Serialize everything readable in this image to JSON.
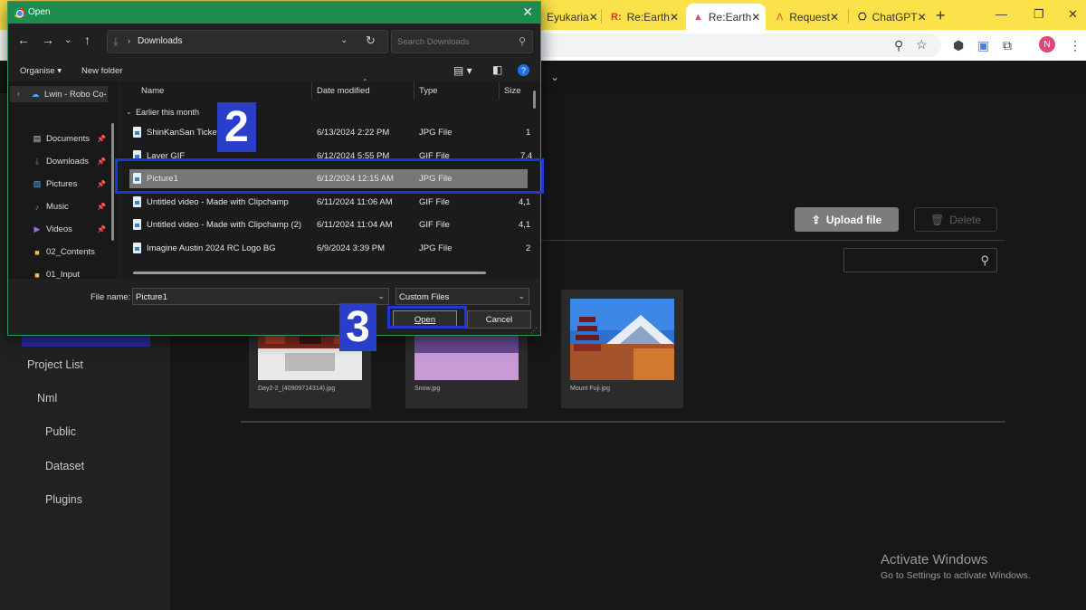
{
  "browser": {
    "tabs": [
      {
        "label": "Eyukaria",
        "icon": "doc-tab-icon"
      },
      {
        "label": "Re:Earth",
        "icon": "reearth-r-icon"
      },
      {
        "label": "Re:Earth",
        "icon": "reearth-a-icon",
        "active": true
      },
      {
        "label": "Request",
        "icon": "reearth-a-icon"
      },
      {
        "label": "ChatGPT",
        "icon": "chatgpt-icon"
      }
    ],
    "avatar_initial": "N",
    "colors": {
      "tabstrip": "#fbe24a",
      "avatar": "#e0457b"
    }
  },
  "app": {
    "sidebar": {
      "items": [
        "Project List",
        "Nml",
        "Public",
        "Dataset",
        "Plugins"
      ]
    },
    "upload_label": "Upload file",
    "delete_label": "Delete",
    "assets": [
      {
        "name": "Day2-2_(40909714314).jpg"
      },
      {
        "name": "Snow.jpg"
      },
      {
        "name": "Mount Fuji.jpg"
      }
    ],
    "watermark": {
      "title": "Activate Windows",
      "subtitle": "Go to Settings to activate Windows."
    }
  },
  "dialog": {
    "title": "Open",
    "breadcrumb": "Downloads",
    "search_placeholder": "Search Downloads",
    "organise_label": "Organise",
    "new_folder_label": "New folder",
    "nav_items": [
      {
        "label": "Lwin - Robo Co-",
        "icon": "onedrive-cloud-icon"
      },
      {
        "label": "Documents",
        "icon": "documents-icon",
        "pinned": true
      },
      {
        "label": "Downloads",
        "icon": "download-icon",
        "pinned": true
      },
      {
        "label": "Pictures",
        "icon": "pictures-icon",
        "pinned": true
      },
      {
        "label": "Music",
        "icon": "music-icon",
        "pinned": true
      },
      {
        "label": "Videos",
        "icon": "videos-icon",
        "pinned": true
      },
      {
        "label": "02_Contents",
        "icon": "folder-icon"
      },
      {
        "label": "01_Input",
        "icon": "folder-icon"
      }
    ],
    "columns": [
      "Name",
      "Date modified",
      "Type",
      "Size"
    ],
    "group_label": "Earlier this month",
    "files": [
      {
        "name": "ShinKanSan Ticket",
        "date": "6/13/2024 2:22 PM",
        "type": "JPG File",
        "size": "1"
      },
      {
        "name": "Layer GIF",
        "date": "6/12/2024 5:55 PM",
        "type": "GIF File",
        "size": "7,4"
      },
      {
        "name": "Picture1",
        "date": "6/12/2024 12:15 AM",
        "type": "JPG File",
        "size": "",
        "selected": true
      },
      {
        "name": "Untitled video - Made with Clipchamp",
        "date": "6/11/2024 11:06 AM",
        "type": "GIF File",
        "size": "4,1"
      },
      {
        "name": "Untitled video - Made with Clipchamp (2)",
        "date": "6/11/2024 11:04 AM",
        "type": "GIF File",
        "size": "4,1"
      },
      {
        "name": "Imagine Austin 2024 RC Logo BG",
        "date": "6/9/2024 3:39 PM",
        "type": "JPG File",
        "size": "2"
      }
    ],
    "file_name_label": "File name:",
    "file_name_value": "Picture1",
    "filter_value": "Custom Files",
    "open_label": "Open",
    "cancel_label": "Cancel",
    "colors": {
      "titlebar": "#1e8c4e",
      "selected_row": "#777777"
    }
  },
  "annotations": {
    "step_select": "2",
    "step_open": "3",
    "color": "#1f36d6"
  }
}
